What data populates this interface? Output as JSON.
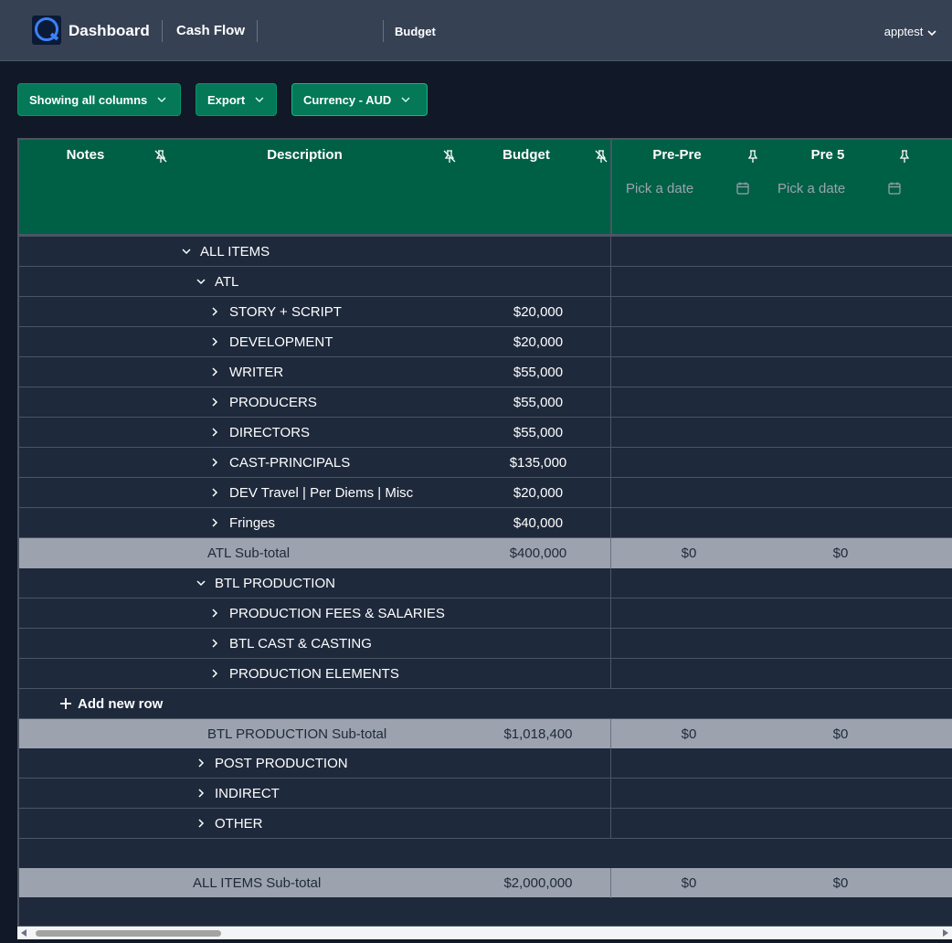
{
  "nav": {
    "title": "Dashboard",
    "cashflow": "Cash Flow",
    "budget": "Budget",
    "user": "apptest"
  },
  "toolbar": {
    "columns_label": "Showing all columns",
    "export_label": "Export",
    "currency_label": "Currency - AUD"
  },
  "columns": {
    "notes": "Notes",
    "description": "Description",
    "budget": "Budget",
    "prepre": "Pre-Pre",
    "pre5": "Pre 5",
    "date_placeholder": "Pick a date"
  },
  "rows": {
    "all_items": "ALL ITEMS",
    "atl": "ATL",
    "story": {
      "label": "STORY + SCRIPT",
      "budget": "$20,000"
    },
    "development": {
      "label": "DEVELOPMENT",
      "budget": "$20,000"
    },
    "writer": {
      "label": "WRITER",
      "budget": "$55,000"
    },
    "producers": {
      "label": "PRODUCERS",
      "budget": "$55,000"
    },
    "directors": {
      "label": "DIRECTORS",
      "budget": "$55,000"
    },
    "cast": {
      "label": "CAST-PRINCIPALS",
      "budget": "$135,000"
    },
    "dev_travel": {
      "label": "DEV Travel | Per Diems | Misc",
      "budget": "$20,000"
    },
    "fringes": {
      "label": "Fringes",
      "budget": "$40,000"
    },
    "atl_sub": {
      "label": "ATL Sub-total",
      "budget": "$400,000",
      "prepre": "$0",
      "pre5": "$0"
    },
    "btl": "BTL PRODUCTION",
    "prod_fees": "PRODUCTION FEES & SALARIES",
    "btl_cast": "BTL CAST & CASTING",
    "prod_elements": "PRODUCTION ELEMENTS",
    "add_row": "Add new row",
    "btl_sub": {
      "label": "BTL PRODUCTION Sub-total",
      "budget": "$1,018,400",
      "prepre": "$0",
      "pre5": "$0"
    },
    "post": "POST PRODUCTION",
    "indirect": "INDIRECT",
    "other": "OTHER",
    "all_sub": {
      "label": "ALL ITEMS Sub-total",
      "budget": "$2,000,000",
      "prepre": "$0",
      "pre5": "$0"
    }
  }
}
